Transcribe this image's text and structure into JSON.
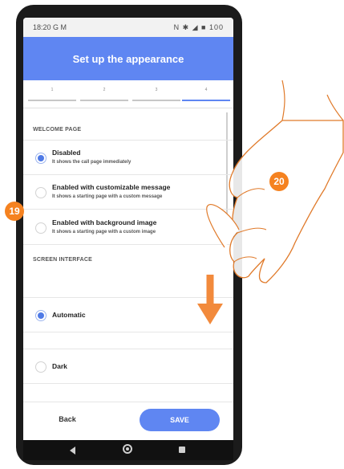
{
  "statusbar": {
    "time": "18:20 G M",
    "icons": "N ✱ ◢ ■ 100"
  },
  "header": {
    "title": "Set up the appearance"
  },
  "steps": [
    "1",
    "2",
    "3",
    "4"
  ],
  "welcome": {
    "title": "WELCOME PAGE",
    "options": [
      {
        "title": "Disabled",
        "subtitle": "It shows the call page immediately",
        "selected": true
      },
      {
        "title": "Enabled with customizable message",
        "subtitle": "It shows a starting page with a custom message",
        "selected": false
      },
      {
        "title": "Enabled with background image",
        "subtitle": "It shows a starting page with a custom image",
        "selected": false
      }
    ]
  },
  "screen_interface": {
    "title": "SCREEN INTERFACE",
    "options": [
      {
        "title": "Automatic",
        "selected": true
      },
      {
        "title": "Dark",
        "selected": false
      }
    ]
  },
  "buttons": {
    "back": "Back",
    "save": "SAVE"
  },
  "annotations": {
    "badge_19": "19",
    "badge_20": "20"
  },
  "colors": {
    "accent": "#5f86f2",
    "badge": "#f58220",
    "phone": "#1b1b1b"
  }
}
